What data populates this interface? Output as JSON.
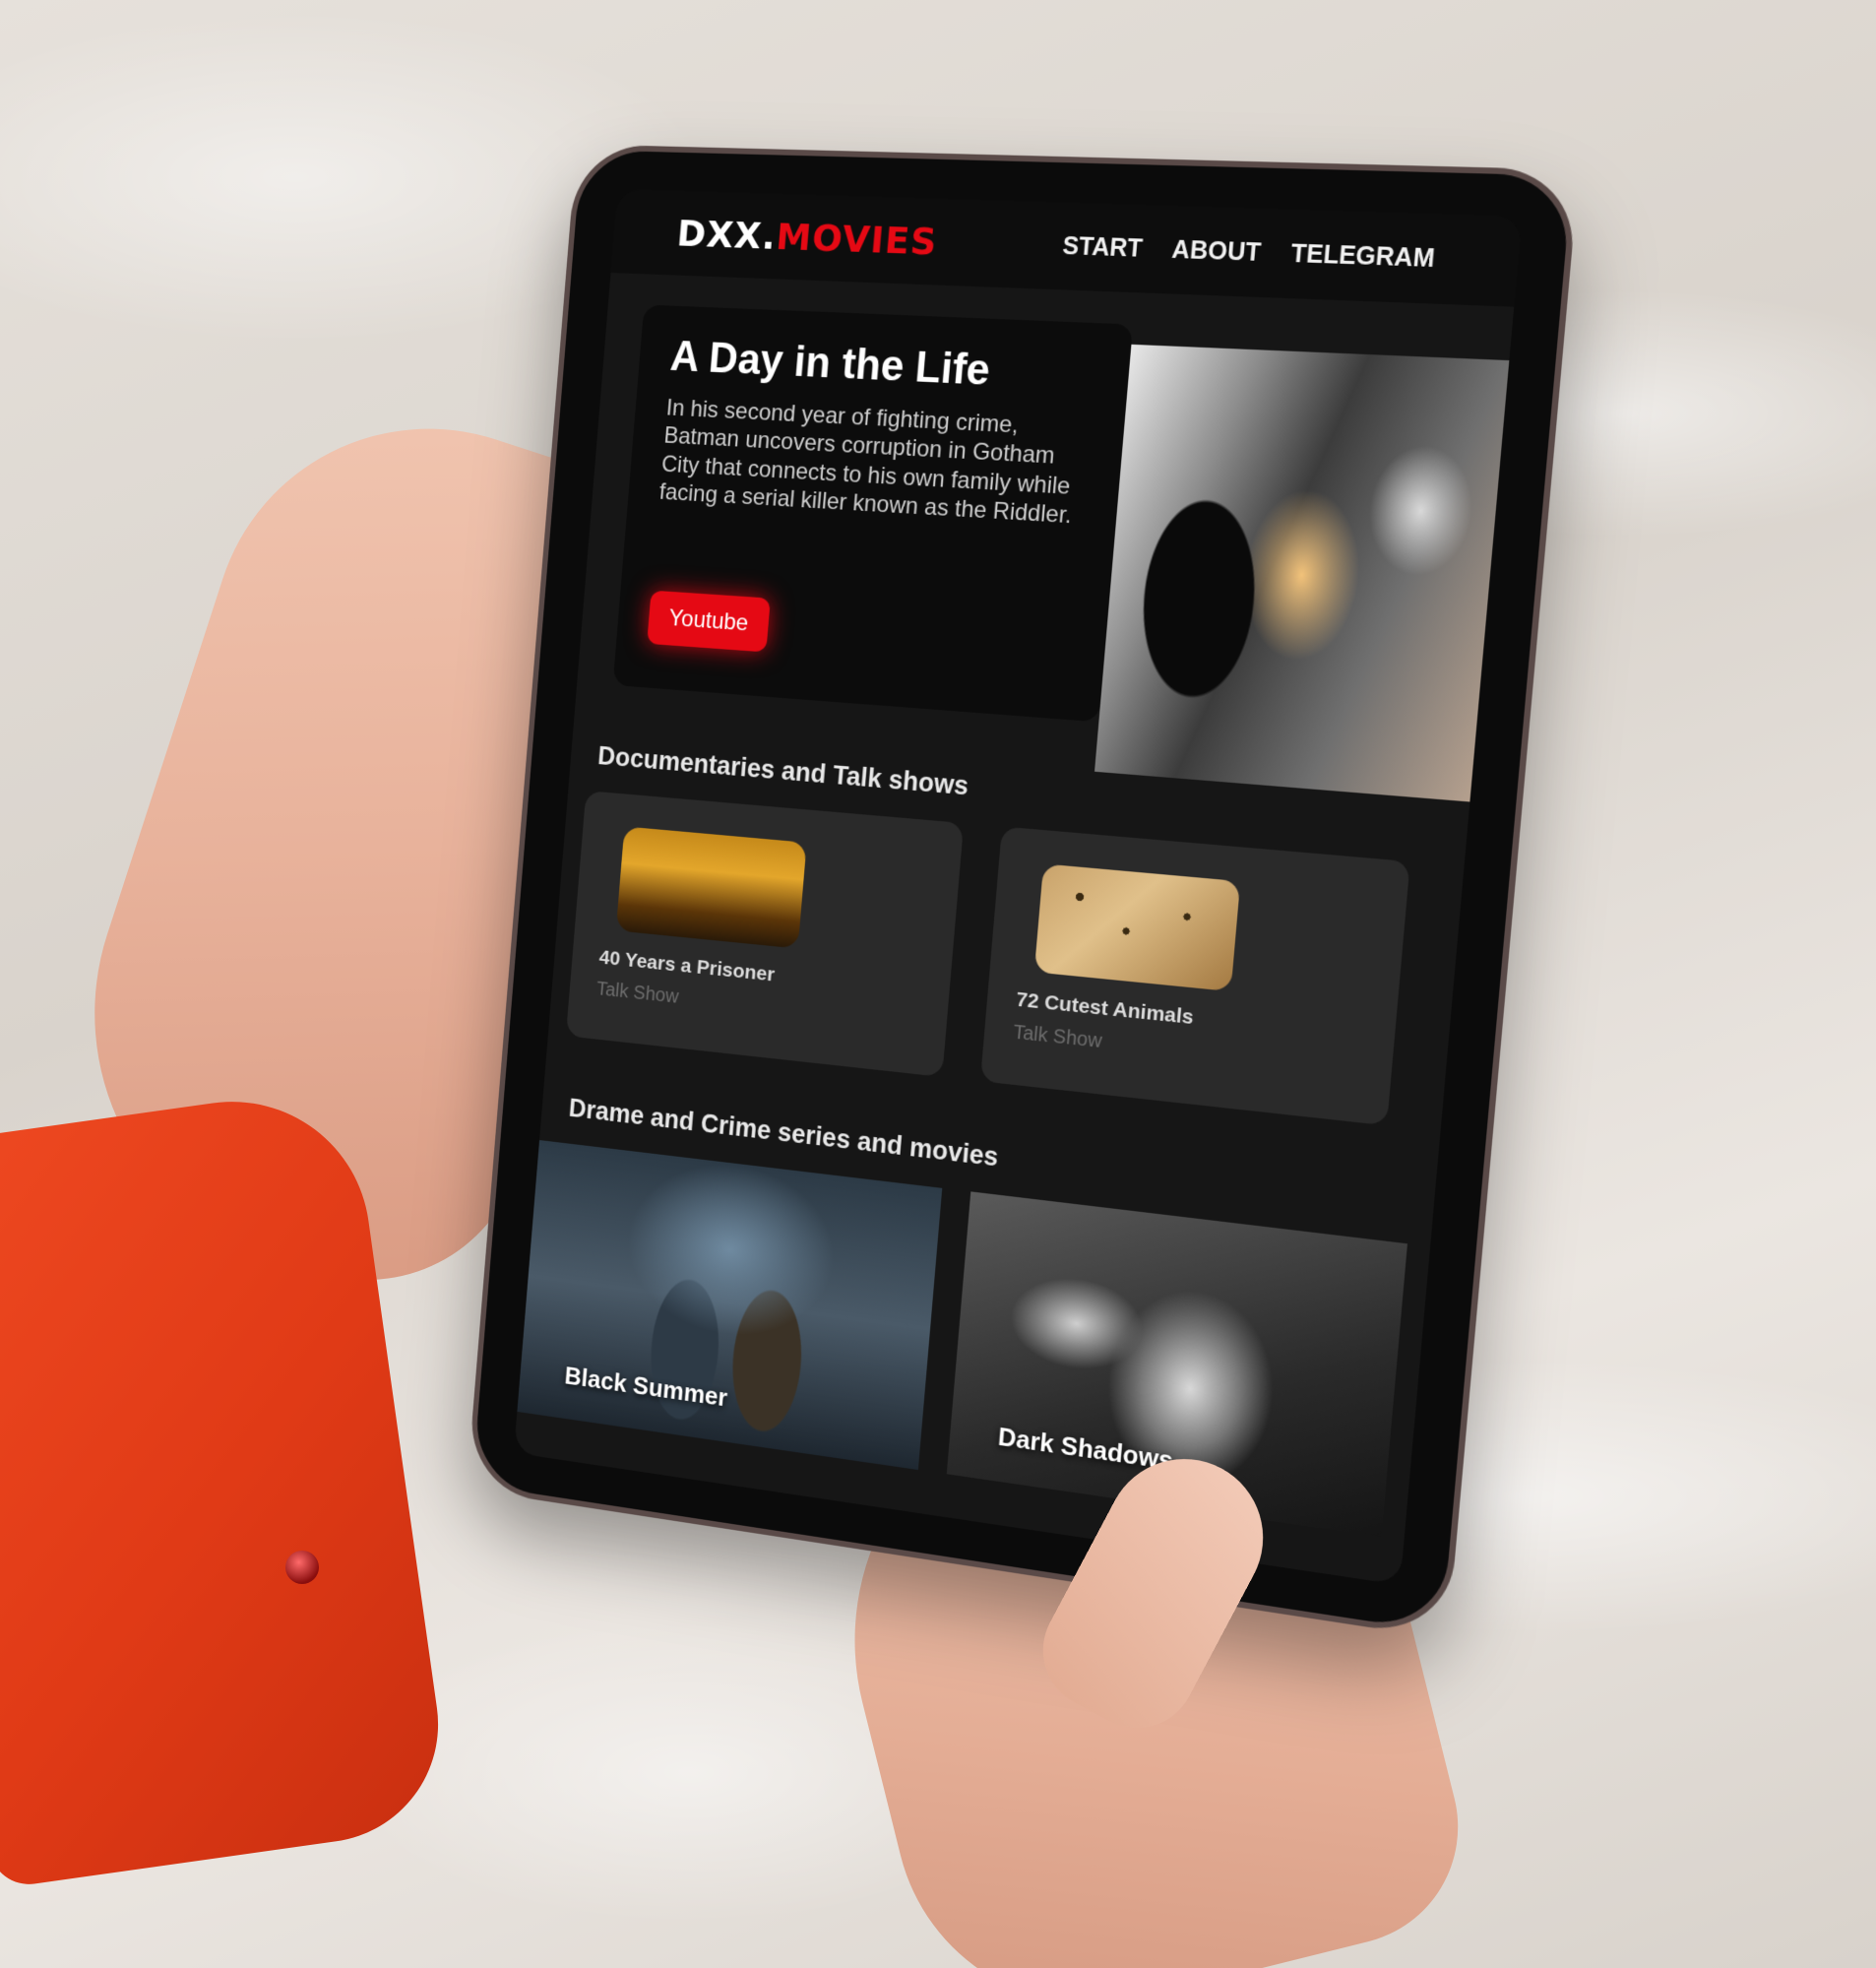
{
  "nav": {
    "logo_part1": "DXX.",
    "logo_part2": "MOVIES",
    "links": [
      "START",
      "ABOUT",
      "TELEGRAM"
    ]
  },
  "hero": {
    "title": "A Day in the Life",
    "description": "In his second year of fighting crime, Batman uncovers corruption in Gotham City that connects to his own family while facing a serial killer known as the Riddler.",
    "button_label": "Youtube"
  },
  "sections": [
    {
      "title": "Documentaries and Talk shows",
      "items": [
        {
          "title": "40 Years a Prisoner",
          "tag": "Talk Show"
        },
        {
          "title": "72 Cutest Animals",
          "tag": "Talk Show"
        }
      ]
    },
    {
      "title": "Drame and Crime series and movies",
      "items": [
        {
          "title": "Black Summer"
        },
        {
          "title": "Dark Shadows"
        }
      ]
    }
  ],
  "colors": {
    "accent": "#e50914",
    "background": "#161616",
    "card": "#2a2a2a",
    "sleeve": "#e63b18"
  }
}
